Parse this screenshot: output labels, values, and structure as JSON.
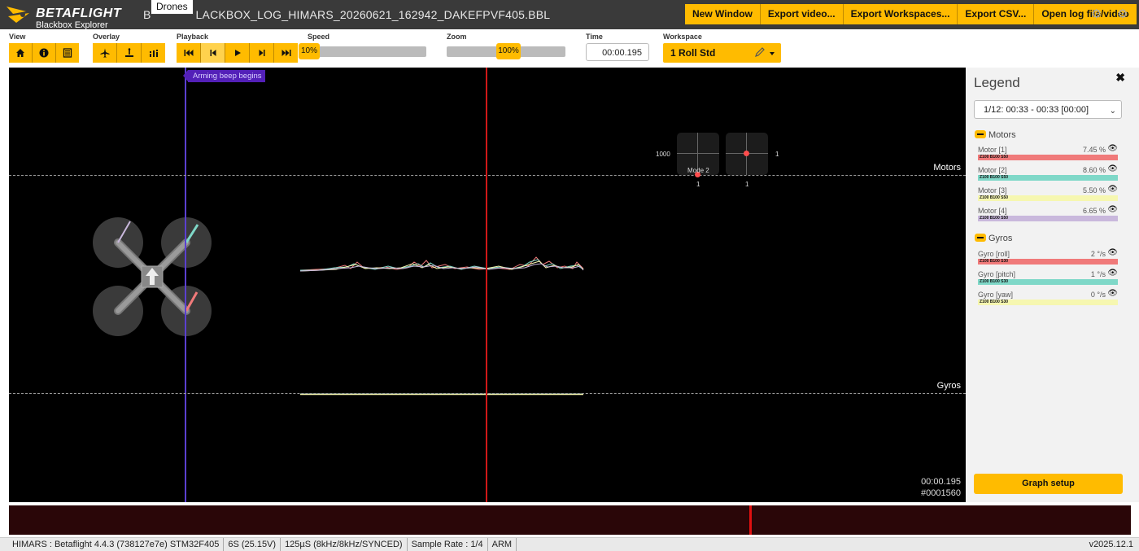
{
  "app": {
    "brand": "BETAFLIGHT",
    "subtitle": "Blackbox Explorer",
    "file_title_prefix": "B",
    "file_title": "LACKBOX_LOG_HIMARS_20260621_162942_DAKEFPVF405.BBL",
    "tooltip": "Drones"
  },
  "top_buttons": [
    "New Window",
    "Export video...",
    "Export Workspaces...",
    "Export CSV...",
    "Open log file/video"
  ],
  "top_icons": [
    "gear-icon",
    "gear-icon"
  ],
  "toolbar": {
    "view_label": "View",
    "view_icons": [
      "home-icon",
      "info-icon",
      "list-icon"
    ],
    "overlay_label": "Overlay",
    "overlay_icons": [
      "aircraft-icon",
      "person-up-icon",
      "bar-chart-icon"
    ],
    "playback_label": "Playback",
    "playback_icons": [
      "skip-to-start-icon",
      "step-back-icon",
      "play-icon",
      "step-forward-icon",
      "skip-to-end-icon"
    ],
    "speed_label": "Speed",
    "speed_value": "10%",
    "speed_fraction": 0.1,
    "zoom_label": "Zoom",
    "zoom_value": "100%",
    "zoom_fraction": 1.0,
    "time_label": "Time",
    "time_value": "00:00.195",
    "workspace_label": "Workspace",
    "workspace_value": "1 Roll Std"
  },
  "graph": {
    "flag_text": "Arming beep begins",
    "motors_label": "Motors",
    "gyros_label": "Gyros",
    "stick_left_label": "1000",
    "stick_left_bottom": "1",
    "stick_left_mode": "Mode 2",
    "stick_right_label": "1",
    "stick_right_bottom": "1",
    "time": "00:00.195",
    "frame": "#0001560"
  },
  "legend": {
    "title": "Legend",
    "range_select": "1/12: 00:33 - 00:33 [00:00]",
    "groups": [
      {
        "name": "Motors",
        "items": [
          {
            "name": "Motor [1]",
            "value": "7.45 %",
            "bar": "Z100 B100 S50",
            "color": "#f07a7a"
          },
          {
            "name": "Motor [2]",
            "value": "8.60 %",
            "bar": "Z100 B100 S50",
            "color": "#7fd8c8"
          },
          {
            "name": "Motor [3]",
            "value": "5.50 %",
            "bar": "Z100 B100 S50",
            "color": "#f6f7b0"
          },
          {
            "name": "Motor [4]",
            "value": "6.65 %",
            "bar": "Z100 B100 S50",
            "color": "#c9b8dc"
          }
        ]
      },
      {
        "name": "Gyros",
        "items": [
          {
            "name": "Gyro [roll]",
            "value": "2 °/s",
            "bar": "Z100 B100 S30",
            "color": "#f07a7a"
          },
          {
            "name": "Gyro [pitch]",
            "value": "1 °/s",
            "bar": "Z100 B100 S30",
            "color": "#7fd8c8"
          },
          {
            "name": "Gyro [yaw]",
            "value": "0 °/s",
            "bar": "Z100 B100 S30",
            "color": "#f6f7b0"
          }
        ]
      }
    ],
    "graph_setup": "Graph setup"
  },
  "status": {
    "items": [
      "HIMARS : Betaflight 4.4.3 (738127e7e) STM32F405",
      "6S (25.15V)",
      "125µS (8kHz/8kHz/SYNCED)",
      "Sample Rate : 1/4",
      "ARM"
    ],
    "version": "v2025.12.1"
  },
  "colors": {
    "accent": "#ffbb00",
    "cursor_red": "#d01818",
    "cursor_purple": "#5b3fd0"
  }
}
